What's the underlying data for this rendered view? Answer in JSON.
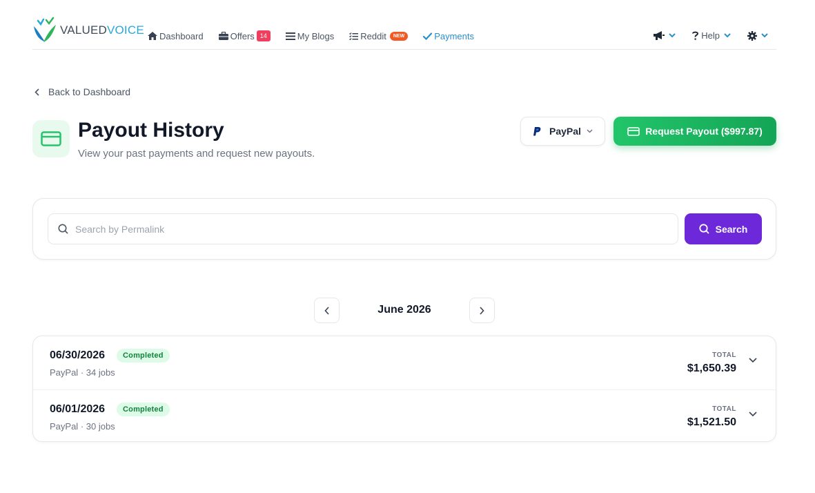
{
  "brand": {
    "name_part1": "VALUED",
    "name_part2": "VOICE"
  },
  "nav": {
    "items": [
      {
        "label": "Dashboard"
      },
      {
        "label": "Offers",
        "badge": "14"
      },
      {
        "label": "My Blogs"
      },
      {
        "label": "Reddit",
        "badge": "NEW"
      },
      {
        "label": "Payments",
        "active": true
      }
    ],
    "help_label": "Help"
  },
  "back_link": "Back to Dashboard",
  "header": {
    "title": "Payout History",
    "subtitle": "View your past payments and request new payouts."
  },
  "payout_method": {
    "selected": "PayPal"
  },
  "request_button": "Request Payout ($997.87)",
  "search": {
    "placeholder": "Search by Permalink",
    "button": "Search"
  },
  "month": "June 2026",
  "payouts": [
    {
      "date": "06/30/2026",
      "status": "Completed",
      "method": "PayPal",
      "jobs": "34 jobs",
      "total_label": "TOTAL",
      "total": "$1,650.39"
    },
    {
      "date": "06/01/2026",
      "status": "Completed",
      "method": "PayPal",
      "jobs": "30 jobs",
      "total_label": "TOTAL",
      "total": "$1,521.50"
    }
  ],
  "colors": {
    "accent_green": "#22c56a",
    "accent_purple": "#6d28d9",
    "active_nav": "#2a8ec9",
    "badge_red": "#ef3e5e",
    "badge_orange": "#f15a24"
  }
}
